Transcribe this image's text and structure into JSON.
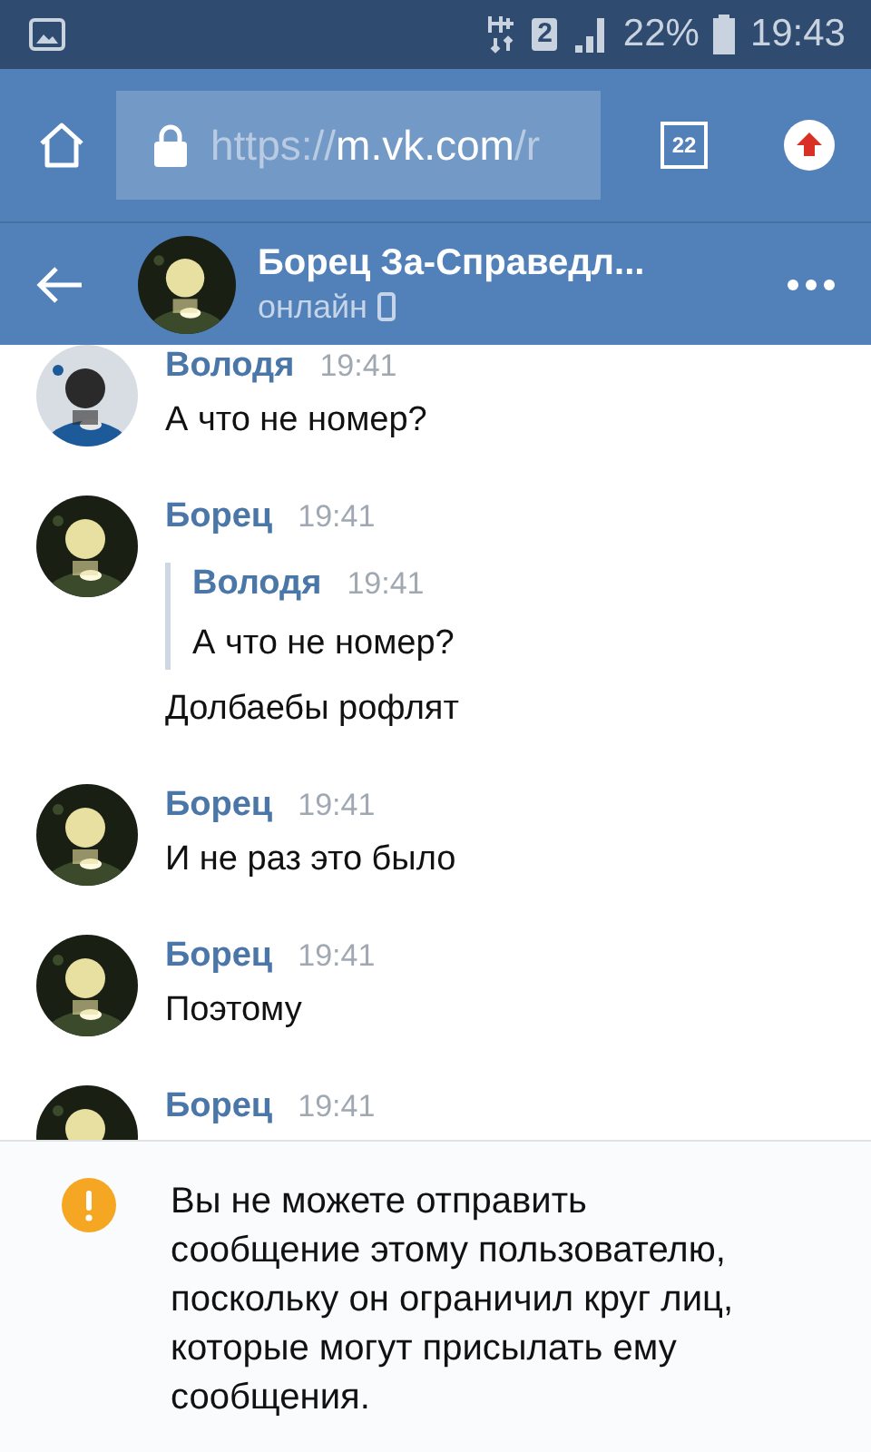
{
  "status_bar": {
    "sim": "2",
    "battery": "22%",
    "time": "19:43"
  },
  "browser": {
    "url_scheme": "https://",
    "url_host": "m.vk.com",
    "url_rest": "/r",
    "tab_count": "22"
  },
  "header": {
    "title": "Борец За-Справедл...",
    "status": "онлайн"
  },
  "messages": [
    {
      "author": "Володя",
      "time": "19:41",
      "avatar": {
        "kind": "light"
      },
      "text": "А что не номер?"
    },
    {
      "author": "Борец",
      "time": "19:41",
      "avatar": {
        "kind": "dark"
      },
      "quote": {
        "author": "Володя",
        "time": "19:41",
        "text": "А что не номер?"
      },
      "text": "Долбаебы рофлят"
    },
    {
      "author": "Борец",
      "time": "19:41",
      "avatar": {
        "kind": "dark"
      },
      "text": "И не раз это было"
    },
    {
      "author": "Борец",
      "time": "19:41",
      "avatar": {
        "kind": "dark"
      },
      "text": "Поэтому"
    },
    {
      "author": "Борец",
      "time": "19:41",
      "avatar": {
        "kind": "dark"
      }
    }
  ],
  "notice": {
    "text": "Вы не можете отправить сообщение этому пользователю, поскольку он ограничил круг лиц, которые могут присылать ему сообщения."
  }
}
